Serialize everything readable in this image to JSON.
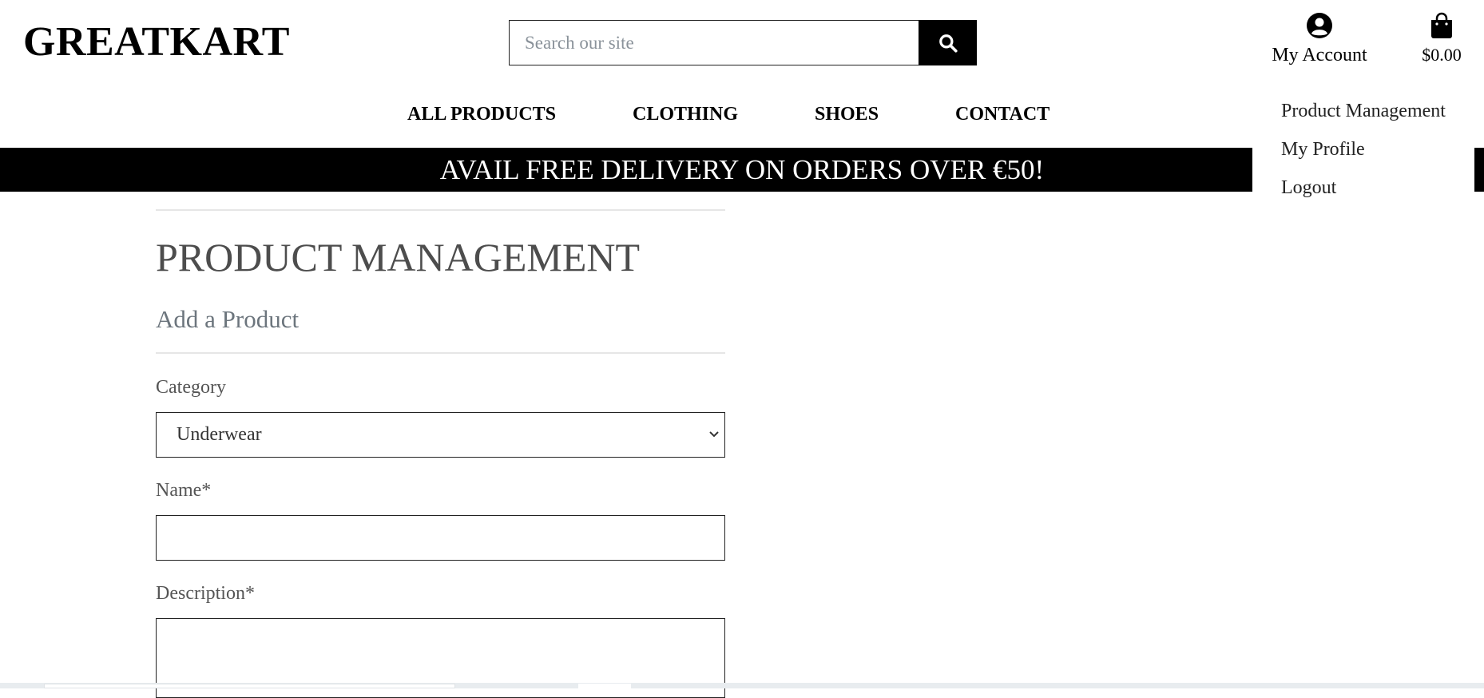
{
  "brand": {
    "logo": "GREATKART"
  },
  "search": {
    "placeholder": "Search our site",
    "icon": "search-icon"
  },
  "account": {
    "label": "My Account",
    "icon": "user-circle-icon"
  },
  "cart": {
    "total": "$0.00",
    "icon": "shopping-bag-icon"
  },
  "nav": {
    "items": [
      "ALL PRODUCTS",
      "CLOTHING",
      "SHOES",
      "CONTACT"
    ]
  },
  "banner": {
    "text": "AVAIL FREE DELIVERY ON ORDERS OVER €50!"
  },
  "account_menu": {
    "items": [
      "Product Management",
      "My Profile",
      "Logout"
    ]
  },
  "page": {
    "title": "PRODUCT MANAGEMENT",
    "subtitle": "Add a Product"
  },
  "form": {
    "category_label": "Category",
    "category_value": "Underwear",
    "name_label": "Name*",
    "name_value": "",
    "description_label": "Description*",
    "description_value": ""
  },
  "colors": {
    "banner_bg": "#000000",
    "banner_text": "#ffffff",
    "heading": "#4d4d4d",
    "muted": "#6c757d"
  }
}
